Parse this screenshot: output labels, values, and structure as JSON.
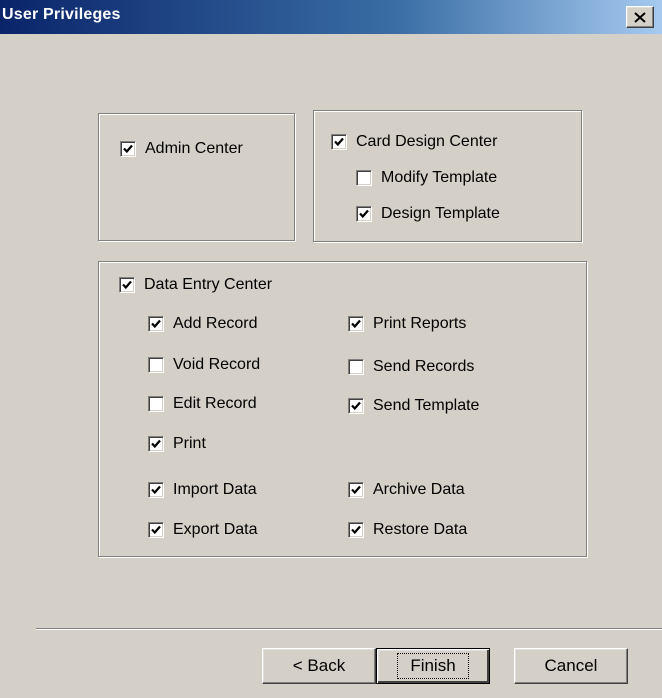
{
  "window": {
    "title": "User Privileges",
    "close_icon": "close-icon"
  },
  "admin_center": {
    "label": "Admin Center",
    "checked": true
  },
  "card_design": {
    "main": {
      "label": "Card Design Center",
      "checked": true
    },
    "modify_template": {
      "label": "Modify Template",
      "checked": false
    },
    "design_template": {
      "label": "Design Template",
      "checked": true
    }
  },
  "data_entry": {
    "main": {
      "label": "Data Entry Center",
      "checked": true
    },
    "add_record": {
      "label": "Add Record",
      "checked": true
    },
    "void_record": {
      "label": "Void Record",
      "checked": false
    },
    "edit_record": {
      "label": "Edit Record",
      "checked": false
    },
    "print": {
      "label": "Print",
      "checked": true
    },
    "import_data": {
      "label": "Import Data",
      "checked": true
    },
    "export_data": {
      "label": "Export Data",
      "checked": true
    },
    "print_reports": {
      "label": "Print Reports",
      "checked": true
    },
    "send_records": {
      "label": "Send Records",
      "checked": false
    },
    "send_template": {
      "label": "Send Template",
      "checked": true
    },
    "archive_data": {
      "label": "Archive Data",
      "checked": true
    },
    "restore_data": {
      "label": "Restore Data",
      "checked": true
    }
  },
  "buttons": {
    "back": "< Back",
    "finish": "Finish",
    "cancel": "Cancel"
  },
  "colors": {
    "titlebar_start": "#0a246a",
    "titlebar_end": "#a6caf0",
    "face": "#d4d0c8"
  }
}
